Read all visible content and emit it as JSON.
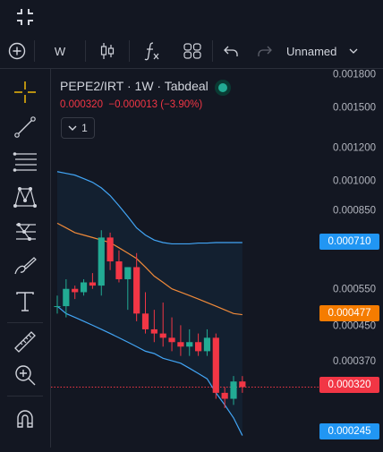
{
  "toolbar": {
    "interval": "W",
    "layout_name": "Unnamed"
  },
  "legend": {
    "symbol": "PEPE2/IRT",
    "interval": "1W",
    "exchange": "Tabdeal",
    "sep": "·",
    "close": "0.000320",
    "change": "−0.000013 (−3.90%)",
    "indicator_count": "1"
  },
  "colors": {
    "up": "#22ab94",
    "down": "#f23645",
    "upper_band": "#42a5f5",
    "middle_band": "#f08a3a",
    "lower_band": "#42a5f5",
    "last_price": "#f23645"
  },
  "price_tags": {
    "upper": {
      "value": "0.000710",
      "color": "#2196f3"
    },
    "middle": {
      "value": "0.000477",
      "color": "#f57c00"
    },
    "last": {
      "value": "0.000320",
      "color": "#f23645"
    },
    "lower": {
      "value": "0.000245",
      "color": "#2196f3"
    }
  },
  "chart_data": {
    "type": "candlestick",
    "symbol": "PEPE2/IRT",
    "interval": "1W",
    "y_ticks": [
      "0.001800",
      "0.001500",
      "0.001200",
      "0.001000",
      "0.000850",
      "0.000550",
      "0.000450",
      "0.000370"
    ],
    "y_scale": "log",
    "candles": [
      {
        "o": 0.0005,
        "h": 0.00053,
        "l": 0.00048,
        "c": 0.0005
      },
      {
        "o": 0.0005,
        "h": 0.00058,
        "l": 0.00047,
        "c": 0.00055
      },
      {
        "o": 0.00055,
        "h": 0.00056,
        "l": 0.00052,
        "c": 0.00054
      },
      {
        "o": 0.00054,
        "h": 0.00058,
        "l": 0.00053,
        "c": 0.00057
      },
      {
        "o": 0.00057,
        "h": 0.0006,
        "l": 0.00055,
        "c": 0.00056
      },
      {
        "o": 0.00056,
        "h": 0.00076,
        "l": 0.00053,
        "c": 0.00073
      },
      {
        "o": 0.00073,
        "h": 0.00075,
        "l": 0.00061,
        "c": 0.00064
      },
      {
        "o": 0.00064,
        "h": 0.00068,
        "l": 0.00057,
        "c": 0.00058
      },
      {
        "o": 0.00058,
        "h": 0.00062,
        "l": 0.00049,
        "c": 0.00062
      },
      {
        "o": 0.00062,
        "h": 0.00067,
        "l": 0.00046,
        "c": 0.00048
      },
      {
        "o": 0.00048,
        "h": 0.00054,
        "l": 0.00043,
        "c": 0.00044
      },
      {
        "o": 0.00044,
        "h": 0.00049,
        "l": 0.00041,
        "c": 0.00043
      },
      {
        "o": 0.00043,
        "h": 0.00051,
        "l": 0.0004,
        "c": 0.00042
      },
      {
        "o": 0.00042,
        "h": 0.00047,
        "l": 0.00039,
        "c": 0.00041
      },
      {
        "o": 0.00041,
        "h": 0.00045,
        "l": 0.00038,
        "c": 0.0004
      },
      {
        "o": 0.0004,
        "h": 0.00044,
        "l": 0.00038,
        "c": 0.00041
      },
      {
        "o": 0.00041,
        "h": 0.00043,
        "l": 0.00038,
        "c": 0.00039
      },
      {
        "o": 0.00039,
        "h": 0.00044,
        "l": 0.00038,
        "c": 0.00042
      },
      {
        "o": 0.00042,
        "h": 0.00043,
        "l": 0.0003,
        "c": 0.00031
      },
      {
        "o": 0.00031,
        "h": 0.00032,
        "l": 0.000285,
        "c": 0.0003
      },
      {
        "o": 0.0003,
        "h": 0.00034,
        "l": 0.00029,
        "c": 0.00033
      },
      {
        "o": 0.00033,
        "h": 0.00034,
        "l": 0.00031,
        "c": 0.00032
      }
    ],
    "upper_band": [
      0.00105,
      0.00104,
      0.00103,
      0.00101,
      0.00099,
      0.00096,
      0.00092,
      0.00087,
      0.00082,
      0.00077,
      0.00074,
      0.00072,
      0.00071,
      0.000705,
      0.000705,
      0.000705,
      0.000708,
      0.000708,
      0.00071,
      0.00071,
      0.00071,
      0.00071
    ],
    "middle_band": [
      0.00079,
      0.00077,
      0.00075,
      0.00074,
      0.00073,
      0.00072,
      0.00071,
      0.00069,
      0.00067,
      0.00065,
      0.00062,
      0.00059,
      0.00057,
      0.00055,
      0.00054,
      0.00053,
      0.00052,
      0.00051,
      0.0005,
      0.00049,
      0.00048,
      0.000477
    ],
    "lower_band": [
      0.0005,
      0.00048,
      0.00047,
      0.00046,
      0.00045,
      0.00044,
      0.00043,
      0.00042,
      0.00041,
      0.0004,
      0.00039,
      0.000385,
      0.000375,
      0.00037,
      0.000365,
      0.000355,
      0.000345,
      0.000335,
      0.00031,
      0.00029,
      0.00027,
      0.000245
    ]
  }
}
